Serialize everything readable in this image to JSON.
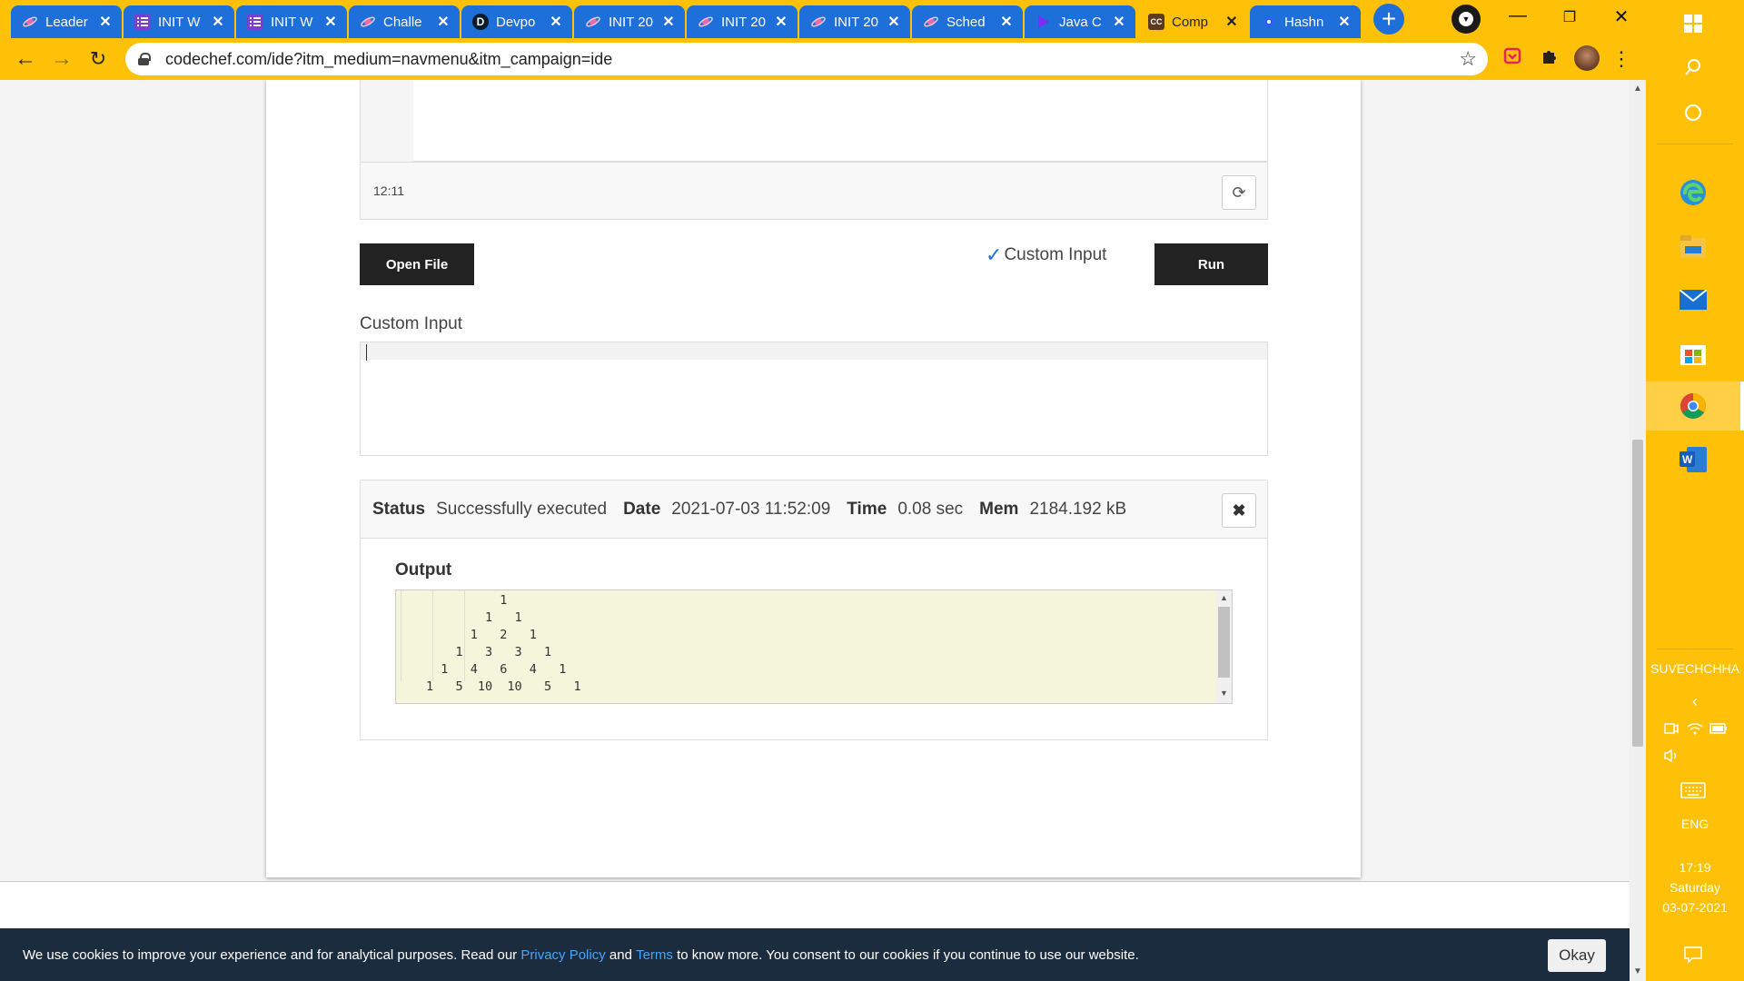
{
  "browser": {
    "tabs": [
      {
        "title": "Leader",
        "icon": "planet-icon",
        "active": false
      },
      {
        "title": "INIT W",
        "icon": "list-icon",
        "active": false
      },
      {
        "title": "INIT W",
        "icon": "list-icon",
        "active": false
      },
      {
        "title": "Challe",
        "icon": "planet-icon",
        "active": false
      },
      {
        "title": "Devpo",
        "icon": "devpost-icon",
        "glyph": "D",
        "active": false
      },
      {
        "title": "INIT 20",
        "icon": "planet-icon",
        "active": false
      },
      {
        "title": "INIT 20",
        "icon": "planet-icon",
        "active": false
      },
      {
        "title": "INIT 20",
        "icon": "planet-icon",
        "active": false
      },
      {
        "title": "Sched",
        "icon": "planet-icon",
        "active": false
      },
      {
        "title": "Java C",
        "icon": "play-icon",
        "active": false
      },
      {
        "title": "Comp",
        "icon": "codechef-icon",
        "glyph": "CC",
        "active": true
      },
      {
        "title": "Hashn",
        "icon": "hashnode-icon",
        "active": false
      }
    ],
    "url": "codechef.com/ide?itm_medium=navmenu&itm_campaign=ide"
  },
  "editor": {
    "cursor_position": "12:11"
  },
  "controls": {
    "open_file_label": "Open File",
    "custom_input_checkbox_label": "Custom Input",
    "run_label": "Run"
  },
  "custom_input": {
    "label": "Custom Input",
    "value": ""
  },
  "result": {
    "status_label": "Status",
    "status_value": "Successfully executed",
    "date_label": "Date",
    "date_value": "2021-07-03 11:52:09",
    "time_label": "Time",
    "time_value": "0.08 sec",
    "mem_label": "Mem",
    "mem_value": "2184.192 kB",
    "output_label": "Output",
    "output_text": "          1\n        1   1\n      1   2   1\n    1   3   3   1\n  1   4   6   4   1\n1   5  10  10   5   1"
  },
  "cookie": {
    "text_before": "We use cookies to improve your experience and for analytical purposes. Read our ",
    "privacy_link": "Privacy Policy",
    "text_and": " and ",
    "terms_link": "Terms",
    "text_after": " to know more. You consent to our cookies if you continue to use our website.",
    "okay_label": "Okay"
  },
  "taskbar": {
    "username": "SUVECHCHHA",
    "language": "ENG",
    "time": "17:19",
    "day": "Saturday",
    "date": "03-07-2021"
  },
  "colors": {
    "chrome_accent": "#ffc107",
    "tab_blue": "#1e6fd9",
    "cookie_bg": "#1b2c3e",
    "output_bg": "#f5f5dc"
  }
}
